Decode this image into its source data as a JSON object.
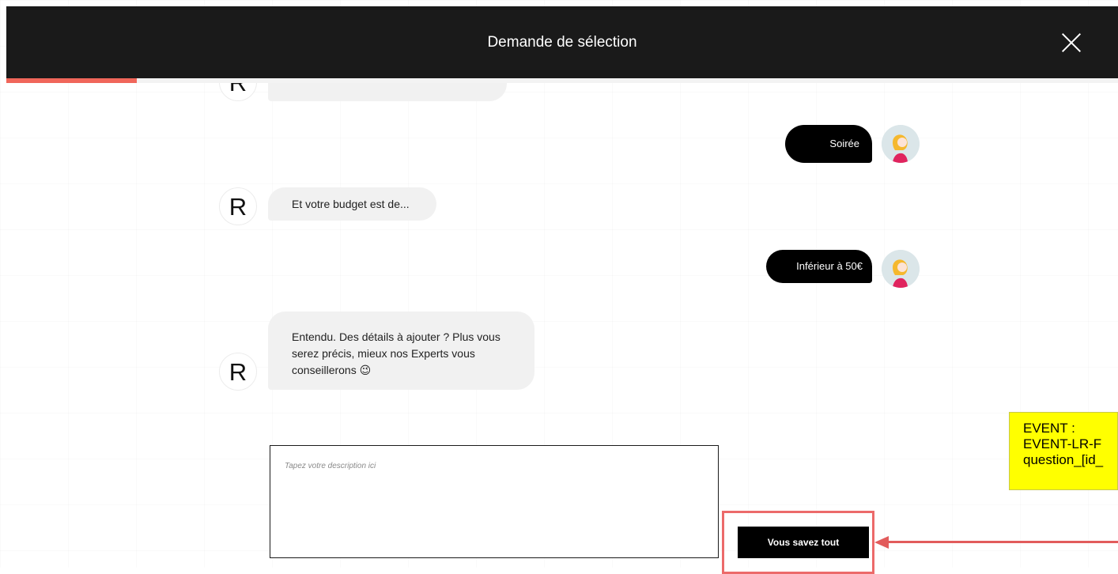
{
  "header": {
    "title": "Demande de sélection",
    "close_icon": "close-icon"
  },
  "progress": {
    "fraction": 0.117,
    "color": "#f0665a"
  },
  "chat": {
    "bot_avatar_letter": "R",
    "user_avatar_icon": "user-avatar-icon",
    "messages": [
      {
        "from": "user",
        "text": "Soirée"
      },
      {
        "from": "bot",
        "text": "Et votre budget est de..."
      },
      {
        "from": "user",
        "text": "Inférieur à 50€"
      },
      {
        "from": "bot",
        "lines": [
          "Entendu. Des détails à ajouter ? Plus vous",
          "serez précis, mieux nos Experts vous",
          "conseillerons"
        ],
        "emoji": "😉"
      }
    ]
  },
  "input": {
    "placeholder": "Tapez votre description ici",
    "value": ""
  },
  "submit": {
    "label": "Vous savez tout"
  },
  "annotation": {
    "lines": [
      "EVENT :",
      "EVENT-LR-F",
      "question_[id_"
    ],
    "note_color": "#ffff00",
    "arrow_color": "#e25c5c"
  }
}
